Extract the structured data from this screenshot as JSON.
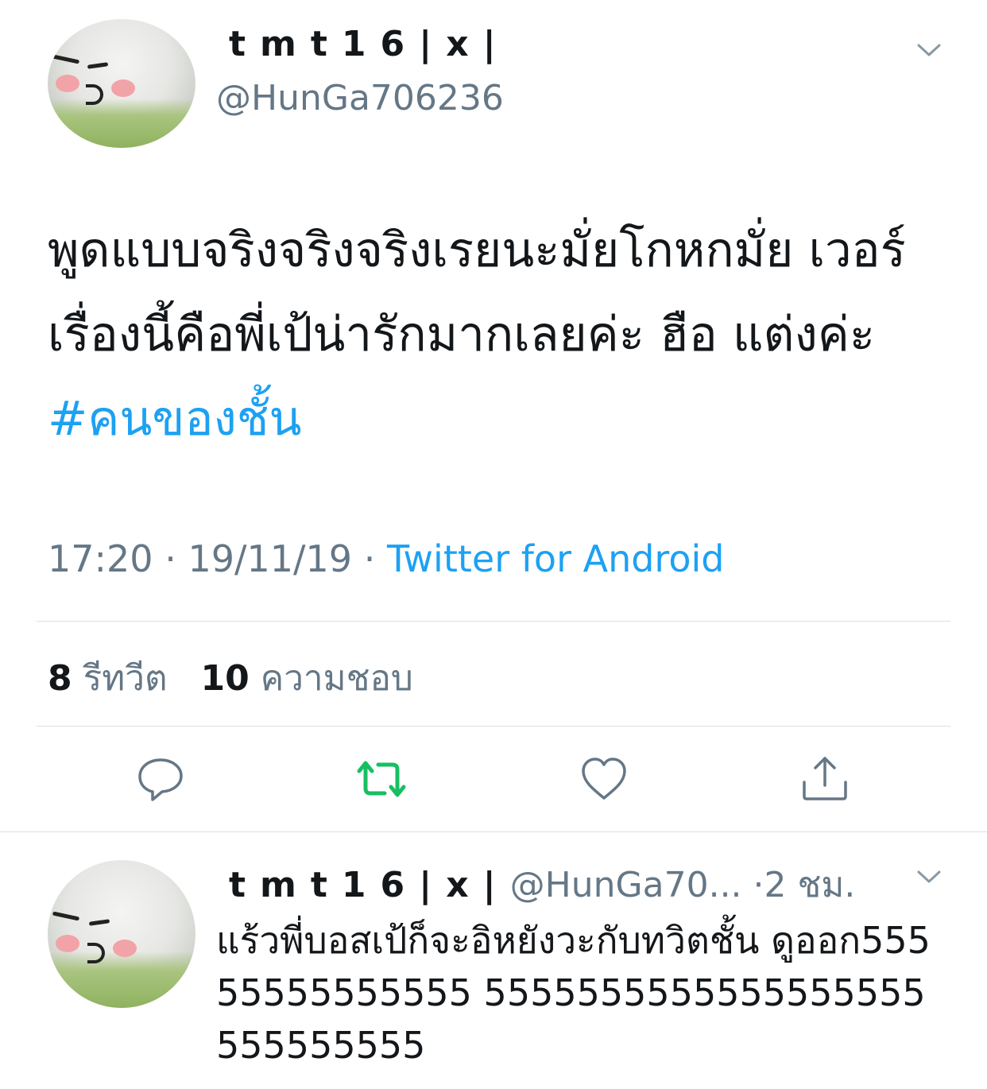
{
  "tweet": {
    "display_name": "tmt16|x|",
    "handle": "@HunGa706236",
    "text": "พูดแบบจริงจริงจริงเรยนะมั่ยโกหกมั่ย เวอร์ เรื่องนี้คือพี่เป้น่ารักมากเลยค่ะ ฮือ แต่งค่ะ ",
    "hashtag": "#คนของชั้น",
    "time": "17:20",
    "date": "19/11/19",
    "source": "Twitter for Android",
    "sep": "·",
    "retweet_count": "8",
    "retweet_label": "รีทวีต",
    "like_count": "10",
    "like_label": "ความชอบ"
  },
  "reply": {
    "display_name": "tmt16|x|",
    "handle": "@HunGa70...",
    "time_ago": "2 ชม.",
    "sep": "·",
    "text": "แร้วพี่บอสเป้ก็จะอิหยังวะกับทวิตชั้น ดูออก55555555555555 5555555555555555555555555555"
  },
  "colors": {
    "accent": "#1da1f2",
    "retweet_active": "#17bf63",
    "secondary_text": "#657786",
    "divider": "#dbe0e4"
  },
  "icons": {
    "reply": "reply-icon",
    "retweet": "retweet-icon",
    "like": "heart-icon",
    "share": "share-icon",
    "menu": "chevron-down-icon"
  }
}
